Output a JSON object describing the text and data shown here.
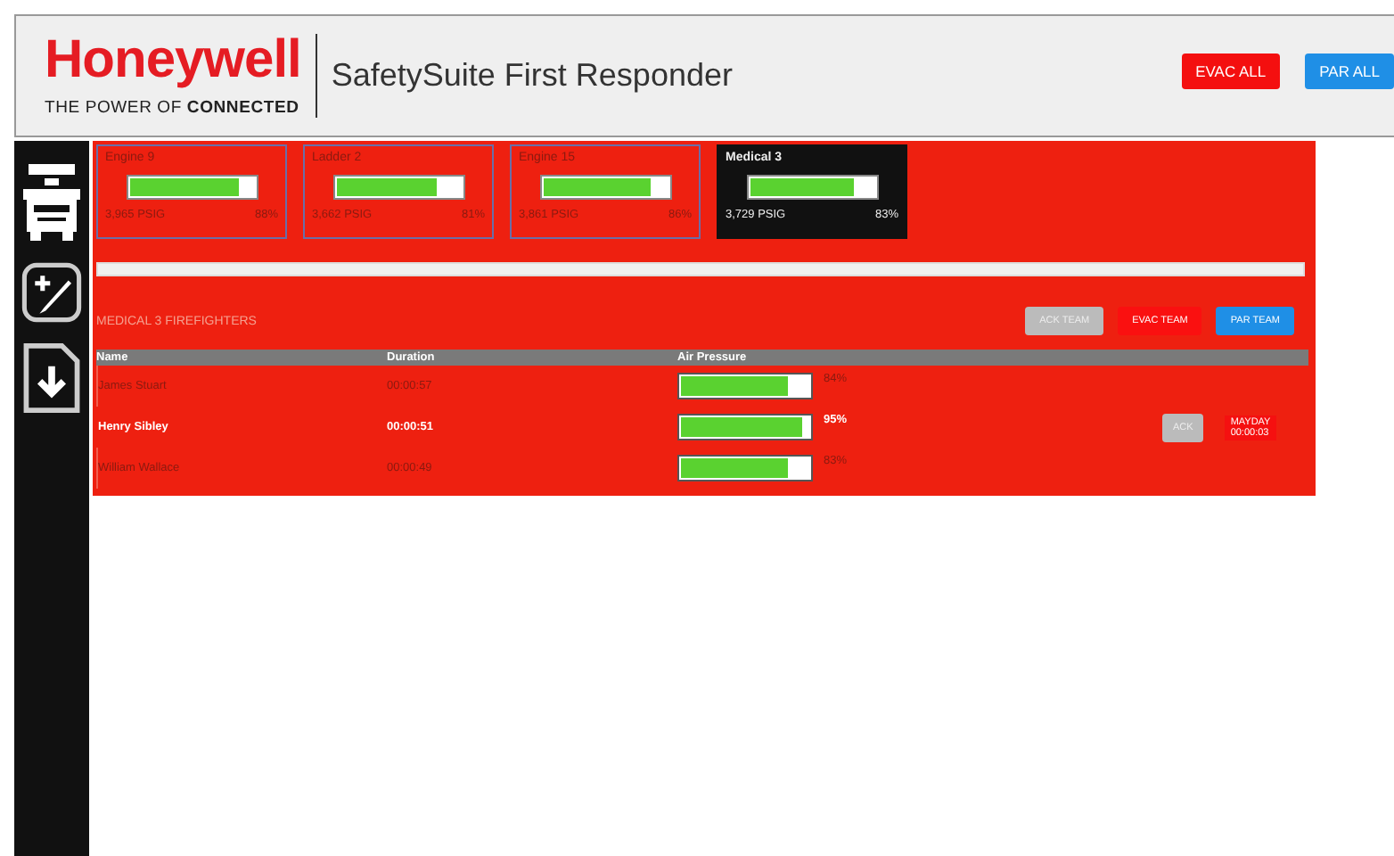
{
  "header": {
    "brand": "Honeywell",
    "tagline_prefix": "THE POWER OF ",
    "tagline_bold": "CONNECTED",
    "title": "SafetySuite First Responder",
    "buttons": [
      {
        "label": "EVAC ALL",
        "kind": "evac"
      },
      {
        "label": "PAR ALL",
        "kind": "par"
      }
    ]
  },
  "vehicles": [
    {
      "name": "Engine 9",
      "level": 0.88,
      "pressure": "3,965 PSIG",
      "percent": "88%",
      "selected": false
    },
    {
      "name": "Ladder 2",
      "level": 0.81,
      "pressure": "3,662 PSIG",
      "percent": "81%",
      "selected": false
    },
    {
      "name": "Engine 15",
      "level": 0.86,
      "pressure": "3,861 PSIG",
      "percent": "86%",
      "selected": false
    },
    {
      "name": "Medical 3",
      "level": 0.83,
      "pressure": "3,729 PSIG",
      "percent": "83%",
      "selected": true
    }
  ],
  "team": {
    "title": "MEDICAL 3 FIREFIGHTERS",
    "buttons": [
      {
        "label": "ACK TEAM",
        "kind": "ack"
      },
      {
        "label": "EVAC TEAM",
        "kind": "evac"
      },
      {
        "label": "PAR TEAM",
        "kind": "par"
      }
    ],
    "columns": [
      "Name",
      "Duration",
      "Air Pressure"
    ],
    "rows": [
      {
        "name": "James Stuart",
        "duration": "00:00:57",
        "level": 0.84,
        "percent": "84%",
        "mayday": false
      },
      {
        "name": "Henry Sibley",
        "duration": "00:00:51",
        "level": 0.95,
        "percent": "95%",
        "mayday": true,
        "ack": "ACK",
        "alert": "MAYDAY",
        "alert_time": "00:00:03"
      },
      {
        "name": "William Wallace",
        "duration": "00:00:49",
        "level": 0.83,
        "percent": "83%",
        "mayday": false
      }
    ]
  }
}
